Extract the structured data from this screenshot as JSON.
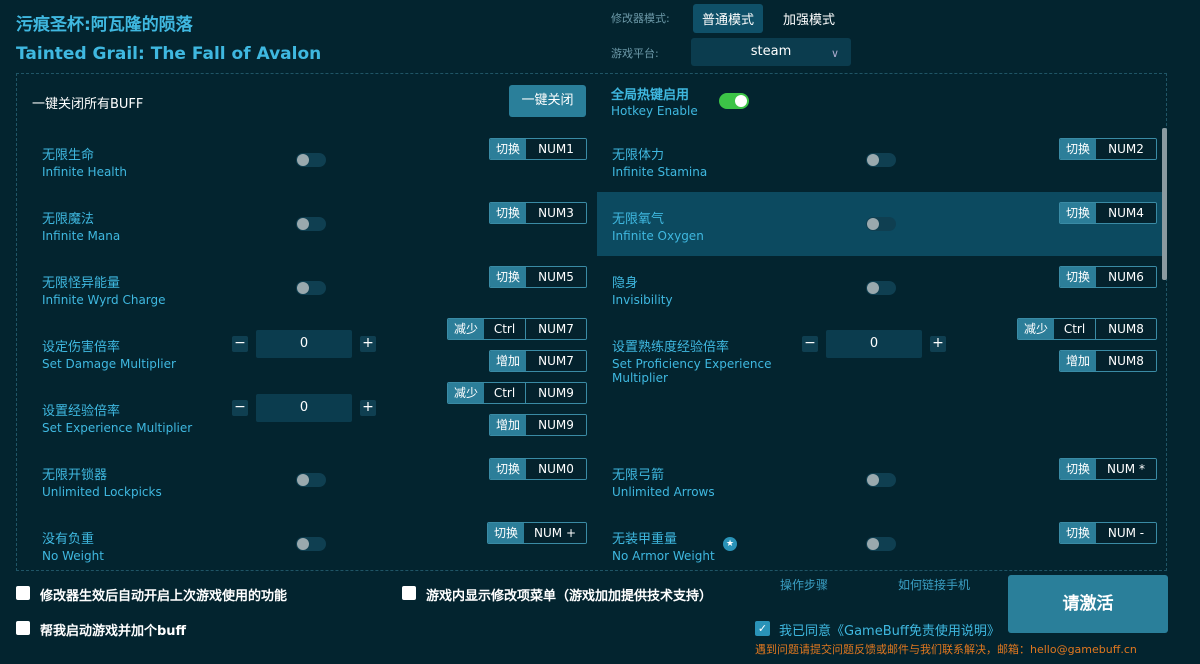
{
  "title_cn": "污痕圣杯:阿瓦隆的陨落",
  "title_en": "Tainted Grail: The Fall of Avalon",
  "mode_label": "修改器模式:",
  "modes": [
    "普通模式",
    "加强模式"
  ],
  "platform_label": "游戏平台:",
  "platform": "steam",
  "close_all_label": "一键关闭所有BUFF",
  "close_all_btn": "一键关闭",
  "hotkey_cn": "全局热键启用",
  "hotkey_en": "Hotkey Enable",
  "hotkey_on": true,
  "items": [
    {
      "cn": "无限生命",
      "en": "Infinite Health",
      "type": "toggle",
      "keys": [
        {
          "tag": "切换",
          "key": "NUM1"
        }
      ]
    },
    {
      "cn": "无限体力",
      "en": "Infinite Stamina",
      "type": "toggle",
      "keys": [
        {
          "tag": "切换",
          "key": "NUM2"
        }
      ]
    },
    {
      "cn": "无限魔法",
      "en": "Infinite Mana",
      "type": "toggle",
      "keys": [
        {
          "tag": "切换",
          "key": "NUM3"
        }
      ]
    },
    {
      "cn": "无限氧气",
      "en": "Infinite Oxygen",
      "type": "toggle",
      "keys": [
        {
          "tag": "切换",
          "key": "NUM4"
        }
      ]
    },
    {
      "cn": "无限怪异能量",
      "en": "Infinite Wyrd Charge",
      "type": "toggle",
      "keys": [
        {
          "tag": "切换",
          "key": "NUM5"
        }
      ]
    },
    {
      "cn": "隐身",
      "en": "Invisibility",
      "type": "toggle",
      "keys": [
        {
          "tag": "切换",
          "key": "NUM6"
        }
      ]
    },
    {
      "cn": "设定伤害倍率",
      "en": "Set Damage Multiplier",
      "type": "number",
      "value": "0",
      "keys": [
        {
          "tag": "减少",
          "mod": "Ctrl",
          "key": "NUM7"
        },
        {
          "tag": "增加",
          "key": "NUM7"
        }
      ]
    },
    {
      "cn": "设置熟练度经验倍率",
      "en": "Set Proficiency Experience Multiplier",
      "type": "number",
      "value": "0",
      "keys": [
        {
          "tag": "减少",
          "mod": "Ctrl",
          "key": "NUM8"
        },
        {
          "tag": "增加",
          "key": "NUM8"
        }
      ]
    },
    {
      "cn": "设置经验倍率",
      "en": "Set Experience Multiplier",
      "type": "number",
      "value": "0",
      "keys": [
        {
          "tag": "减少",
          "mod": "Ctrl",
          "key": "NUM9"
        },
        {
          "tag": "增加",
          "key": "NUM9"
        }
      ]
    },
    null,
    {
      "cn": "无限开锁器",
      "en": "Unlimited Lockpicks",
      "type": "toggle",
      "keys": [
        {
          "tag": "切换",
          "key": "NUM0"
        }
      ]
    },
    {
      "cn": "无限弓箭",
      "en": "Unlimited Arrows",
      "type": "toggle",
      "keys": [
        {
          "tag": "切换",
          "key": "NUM *"
        }
      ]
    },
    {
      "cn": "没有负重",
      "en": "No Weight",
      "type": "toggle",
      "keys": [
        {
          "tag": "切换",
          "key": "NUM +"
        }
      ]
    },
    {
      "cn": "无装甲重量",
      "en": "No Armor Weight",
      "type": "toggle",
      "star": true,
      "keys": [
        {
          "tag": "切换",
          "key": "NUM -"
        }
      ]
    }
  ],
  "opt1": "修改器生效后自动开启上次游戏使用的功能",
  "opt2": "游戏内显示修改项菜单（游戏加加提供技术支持）",
  "opt3": "帮我启动游戏并加个buff",
  "link_steps": "操作步骤",
  "link_phone": "如何链接手机",
  "activate": "请激活",
  "agree": "我已同意《GameBuff免责使用说明》",
  "contact": "遇到问题请提交问题反馈或邮件与我们联系解决，邮箱：hello@gamebuff.cn"
}
